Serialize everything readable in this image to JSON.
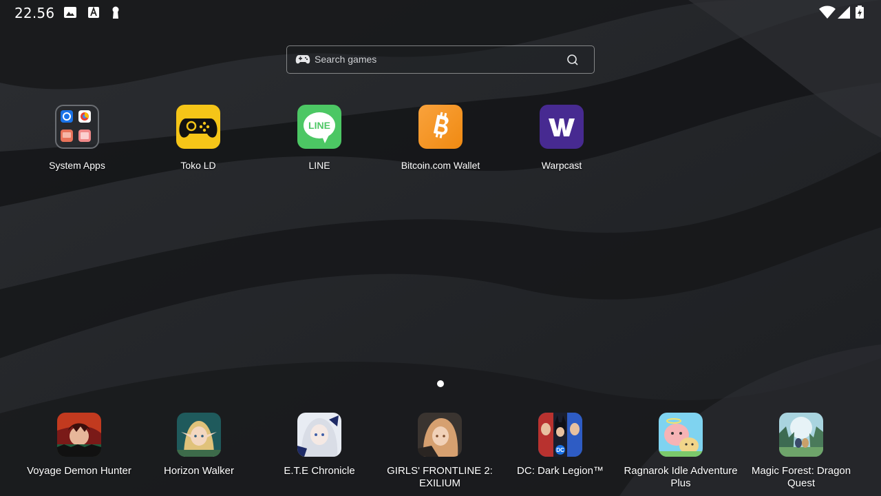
{
  "status_bar": {
    "time": "22.56",
    "left_icons": [
      "image-icon",
      "font-a-icon",
      "keyhole-icon"
    ],
    "right_icons": [
      "wifi-icon",
      "signal-icon",
      "battery-charging-icon"
    ]
  },
  "search": {
    "placeholder": "Search games"
  },
  "apps": [
    {
      "label": "System Apps",
      "icon": "folder-icon"
    },
    {
      "label": "Toko LD",
      "icon": "gamepad-icon",
      "color": "#f5c518"
    },
    {
      "label": "LINE",
      "icon": "line-icon",
      "color": "#4cc764",
      "icon_text": "LINE"
    },
    {
      "label": "Bitcoin.com Wallet",
      "icon": "bitcoin-icon",
      "color": "#f7931a"
    },
    {
      "label": "Warpcast",
      "icon": "warpcast-icon",
      "color": "#472a91"
    }
  ],
  "page_indicator": {
    "pages": 1,
    "current": 1
  },
  "dock": [
    {
      "label": "Voyage Demon Hunter",
      "icon": "voyage-demon-hunter-icon"
    },
    {
      "label": "Horizon Walker",
      "icon": "horizon-walker-icon"
    },
    {
      "label": "E.T.E Chronicle",
      "icon": "ete-chronicle-icon"
    },
    {
      "label": "GIRLS' FRONTLINE 2: EXILIUM",
      "icon": "girls-frontline-2-icon"
    },
    {
      "label": "DC: Dark Legion™",
      "icon": "dc-dark-legion-icon"
    },
    {
      "label": "Ragnarok Idle Adventure Plus",
      "icon": "ragnarok-idle-icon"
    },
    {
      "label": "Magic Forest: Dragon Quest",
      "icon": "magic-forest-icon"
    }
  ]
}
